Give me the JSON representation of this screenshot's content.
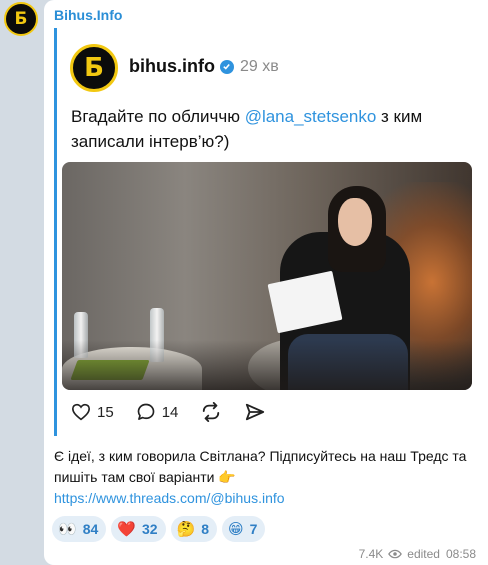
{
  "channel": {
    "name": "Bihus.Info",
    "avatar_glyph": "Б"
  },
  "embed": {
    "avatar_glyph": "Б",
    "title": "bihus.info",
    "time": "29 хв",
    "text_before": "Вгадайте по обличчю ",
    "mention": "@lana_stetsenko",
    "text_after": " з ким записали інтерв’ю?)",
    "actions": {
      "likes": "15",
      "comments": "14"
    }
  },
  "post": {
    "text": "Є ідеї, з ким говорила Світлана? Підписуйтесь на наш Тредс та пишіть там свої варіанти 👉",
    "link": "https://www.threads.com/@bihus.info"
  },
  "reactions": [
    {
      "emoji": "👀",
      "count": "84"
    },
    {
      "emoji": "❤️",
      "count": "32"
    },
    {
      "emoji": "🤔",
      "count": "8"
    },
    {
      "emoji": "😁",
      "count": "7"
    }
  ],
  "meta": {
    "views": "7.4K",
    "edited": "edited",
    "time": "08:58"
  },
  "colors": {
    "accent": "#2f93de",
    "brand_yellow": "#f2c811",
    "chat_bg": "#d3dbe3"
  }
}
